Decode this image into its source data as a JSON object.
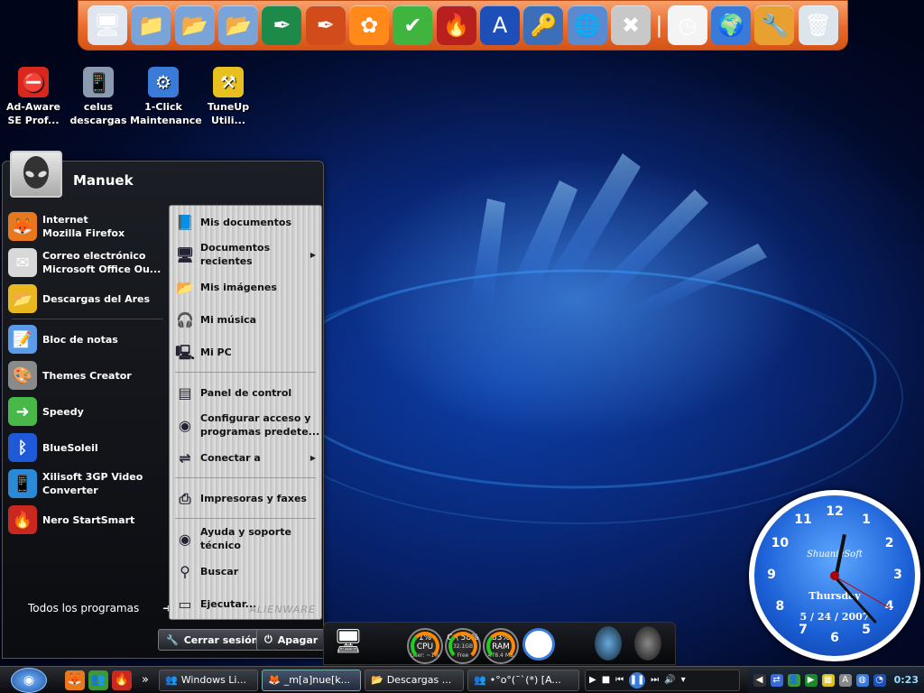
{
  "colors": {
    "dock_orange": "#e86a2c",
    "desktop_blue": "#0b3ea8",
    "menu_dark": "#14161a",
    "clock_blue": "#1b5fd6"
  },
  "dock": {
    "icons": [
      {
        "name": "notepad-doc-icon",
        "glyph": "🖥",
        "color": "#dfe6f0"
      },
      {
        "name": "folder-icon",
        "glyph": "📁",
        "color": "#7aa4d8"
      },
      {
        "name": "folder-pictures-icon",
        "glyph": "📂",
        "color": "#7aa4d8"
      },
      {
        "name": "folder-music-icon",
        "glyph": "📂",
        "color": "#7aa4d8"
      },
      {
        "name": "feather-icon",
        "glyph": "✒",
        "color": "#1e8a4a"
      },
      {
        "name": "feather-red-icon",
        "glyph": "✒",
        "color": "#d24b1a"
      },
      {
        "name": "flower-icon",
        "glyph": "✿",
        "color": "#ff8a1a"
      },
      {
        "name": "green-check-icon",
        "glyph": "✔",
        "color": "#3fb43f"
      },
      {
        "name": "nero-flame-icon",
        "glyph": "🔥",
        "color": "#b81f1f"
      },
      {
        "name": "ares-icon",
        "glyph": "A",
        "color": "#1e4fb8"
      },
      {
        "name": "keys-icon",
        "glyph": "🔑",
        "color": "#3d6fb8"
      },
      {
        "name": "network-icon",
        "glyph": "🌐",
        "color": "#5a8ad0"
      },
      {
        "name": "tools-icon",
        "glyph": "✖",
        "color": "#c8c8c8"
      },
      {
        "name": "separator-icon",
        "glyph": "|",
        "color": "#c85010"
      },
      {
        "name": "clock-icon",
        "glyph": "◷",
        "color": "#f4f4f4"
      },
      {
        "name": "globe-icon",
        "glyph": "🌍",
        "color": "#3a7ad8"
      },
      {
        "name": "wrench-hammer-icon",
        "glyph": "🔧",
        "color": "#e8a030"
      },
      {
        "name": "recycle-bin-icon",
        "glyph": "🗑",
        "color": "#dce4ec"
      }
    ]
  },
  "desktop_icons": [
    {
      "name": "desktop-icon-adaware",
      "line1": "Ad-Aware",
      "line2": "SE Prof...",
      "glyph": "⛔",
      "color": "#d8281e"
    },
    {
      "name": "desktop-icon-celus",
      "line1": "celus",
      "line2": "descargas",
      "glyph": "📱",
      "color": "#8a9ab0"
    },
    {
      "name": "desktop-icon-oneclick",
      "line1": "1-Click",
      "line2": "Maintenance",
      "glyph": "⚙",
      "color": "#3a7ad8"
    },
    {
      "name": "desktop-icon-tuneup",
      "line1": "TuneUp",
      "line2": "Utili...",
      "glyph": "⚒",
      "color": "#e8c020"
    }
  ],
  "start_menu": {
    "user_name": "Manuek",
    "left_items": [
      {
        "name": "pinned-internet",
        "line1": "Internet",
        "line2": "Mozilla Firefox",
        "glyph": "🦊",
        "color": "#e8781e"
      },
      {
        "name": "pinned-email",
        "line1": "Correo electrónico",
        "line2": "Microsoft Office Ou...",
        "glyph": "✉",
        "color": "#d8d8d8"
      },
      {
        "name": "pinned-ares",
        "line1": "Descargas del Ares",
        "line2": "",
        "glyph": "📂",
        "color": "#e8b81e"
      },
      {
        "name": "recent-notepad",
        "line1": "Bloc de notas",
        "line2": "",
        "glyph": "📝",
        "color": "#5a9ae8"
      },
      {
        "name": "recent-themes",
        "line1": "Themes Creator",
        "line2": "",
        "glyph": "🎨",
        "color": "#8a8a8a"
      },
      {
        "name": "recent-speedy",
        "line1": "Speedy",
        "line2": "",
        "glyph": "➜",
        "color": "#48b848"
      },
      {
        "name": "recent-bluesoleil",
        "line1": "BlueSoleil",
        "line2": "",
        "glyph": "ᛒ",
        "color": "#1e5ad8"
      },
      {
        "name": "recent-xilisoft",
        "line1": "Xilisoft 3GP Video",
        "line2": "Converter",
        "glyph": "📱",
        "color": "#2a8ad8"
      },
      {
        "name": "recent-nero",
        "line1": "Nero StartSmart",
        "line2": "",
        "glyph": "🔥",
        "color": "#c8281e"
      }
    ],
    "all_programs": "Todos los programas",
    "right_items": [
      {
        "name": "right-my-documents",
        "line1": "Mis documentos",
        "line2": "",
        "glyph": "📘",
        "arrow": false,
        "sep_after": false
      },
      {
        "name": "right-recent-docs",
        "line1": "Documentos recientes",
        "line2": "",
        "glyph": "🖥",
        "arrow": true,
        "sep_after": false
      },
      {
        "name": "right-my-pictures",
        "line1": "Mis imágenes",
        "line2": "",
        "glyph": "📂",
        "arrow": false,
        "sep_after": false
      },
      {
        "name": "right-my-music",
        "line1": "Mi música",
        "line2": "",
        "glyph": "🎧",
        "arrow": false,
        "sep_after": false
      },
      {
        "name": "right-my-pc",
        "line1": "Mi PC",
        "line2": "",
        "glyph": "🖳",
        "arrow": false,
        "sep_after": true
      },
      {
        "name": "right-control-panel",
        "line1": "Panel de control",
        "line2": "",
        "glyph": "▤",
        "arrow": false,
        "sep_after": false
      },
      {
        "name": "right-configure-access",
        "line1": "Configurar acceso y",
        "line2": "programas predete...",
        "glyph": "◉",
        "arrow": false,
        "sep_after": false
      },
      {
        "name": "right-connect-to",
        "line1": "Conectar a",
        "line2": "",
        "glyph": "⇌",
        "arrow": true,
        "sep_after": true
      },
      {
        "name": "right-printers",
        "line1": "Impresoras y faxes",
        "line2": "",
        "glyph": "⎙",
        "arrow": false,
        "sep_after": true
      },
      {
        "name": "right-help",
        "line1": "Ayuda y soporte",
        "line2": "técnico",
        "glyph": "◉",
        "arrow": false,
        "sep_after": false
      },
      {
        "name": "right-search",
        "line1": "Buscar",
        "line2": "",
        "glyph": "⚲",
        "arrow": false,
        "sep_after": false
      },
      {
        "name": "right-run",
        "line1": "Ejecutar...",
        "line2": "",
        "glyph": "▭",
        "arrow": false,
        "sep_after": false
      }
    ],
    "brand": "ALIENWARE",
    "logoff_label": "Cerrar sesión",
    "shutdown_label": "Apagar"
  },
  "widgets": {
    "cpu": {
      "percent": "1%",
      "label": "CPU",
      "sub": "User: ~1%"
    },
    "disk": {
      "percent": "58%",
      "label": "C:\\ 58%",
      "sub": "32.1GB Free"
    },
    "ram": {
      "percent": "83%",
      "label": "RAM",
      "sub": "478.4 MB"
    }
  },
  "clock": {
    "brand": "ShuanieSoft",
    "day": "Thursday",
    "date": "5 / 24 / 2007",
    "numbers": [
      "12",
      "1",
      "2",
      "3",
      "4",
      "5",
      "6",
      "7",
      "8",
      "9",
      "10",
      "11"
    ],
    "hour": 12,
    "minute": 23,
    "second": 20
  },
  "taskbar": {
    "tasks": [
      {
        "name": "task-windows-live",
        "label": "Windows Li...",
        "glyph": "👥",
        "active": false
      },
      {
        "name": "task-firefox",
        "label": "_m[a]nue[k...",
        "glyph": "🦊",
        "active": true
      },
      {
        "name": "task-downloads",
        "label": "Descargas ...",
        "glyph": "📂",
        "active": false
      },
      {
        "name": "task-messenger",
        "label": "•°o°(¯`(*) [A...",
        "glyph": "👥",
        "active": false
      }
    ],
    "time": "0:23"
  }
}
